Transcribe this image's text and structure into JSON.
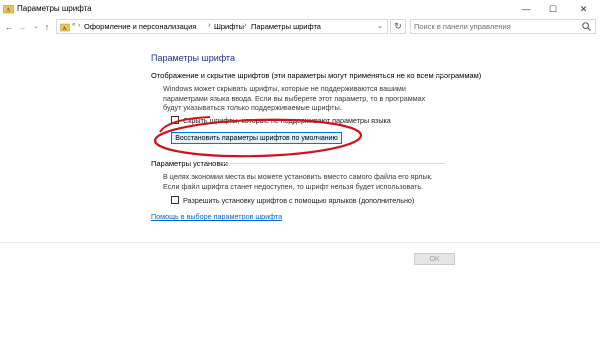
{
  "window": {
    "title": "Параметры шрифта",
    "controls": {
      "minimize": "—",
      "maximize": "☐",
      "close": "✕"
    }
  },
  "address_bar": {
    "overflow": "«",
    "breadcrumbs": [
      "Оформление и персонализация",
      "Шрифты",
      "Параметры шрифта"
    ],
    "separator": "›",
    "dropdown": "⌄",
    "refresh": "↻",
    "search_placeholder": "Поиск в панели управления"
  },
  "nav": {
    "back": "←",
    "forward": "→",
    "recent": "⌄",
    "up": "↑"
  },
  "main": {
    "heading": "Параметры шрифта",
    "hide_section": {
      "title": "Отображение и скрытие шрифтов (эти параметры могут применяться не ко всем программам)",
      "description": "Windows может скрывать шрифты, которые не поддерживаются вашими параметрами языка ввода. Если вы выберете этот параметр, то в программах будут указываться только поддерживаемые шрифты.",
      "checkbox_visible_label_start": "Скрыть шрифты, которые не поддерживают параметры языка",
      "checkbox_checked": false,
      "restore_button": "Восстановить параметры шрифтов по умолчанию"
    },
    "install_section": {
      "title": "Параметры установки",
      "description": "В целях экономии места вы можете установить вместо самого файла его ярлык. Если файл шрифта станет недоступен, то шрифт нельзя будет использовать.",
      "checkbox_label": "Разрешить установку шрифтов с помощью ярлыков (дополнительно)",
      "checkbox_checked": false
    },
    "help_link": "Помощь в выборе параметров шрифта",
    "ok_button": "OK"
  },
  "colors": {
    "heading": "#1e3287",
    "link": "#0066cc",
    "annotation": "#d0121b",
    "button_border": "#0078d7"
  }
}
